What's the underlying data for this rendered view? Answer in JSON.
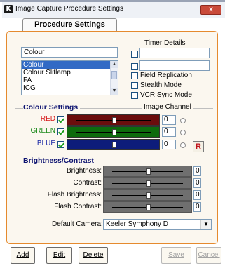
{
  "window": {
    "title": "Image Capture Procedure Settings",
    "close_glyph": "✕"
  },
  "tab": {
    "label": "Procedure Settings"
  },
  "procedure": {
    "input_value": "Colour",
    "list": [
      "Colour",
      "Colour Slitlamp",
      "FA",
      "ICG"
    ],
    "selected_index": 0
  },
  "timer": {
    "title": "Timer Details",
    "field1": "",
    "field2": ""
  },
  "options": [
    {
      "label": "Field Replication",
      "checked": false
    },
    {
      "label": "Stealth Mode",
      "checked": false
    },
    {
      "label": "VCR Sync Mode",
      "checked": false
    }
  ],
  "colour_settings": {
    "title": "Colour Settings",
    "image_channel_title": "Image Channel",
    "reset_label": "R",
    "channels": [
      {
        "label": "RED",
        "checked": true,
        "value": "0",
        "level": 0.5,
        "color": "#d61a1a",
        "track": "#6b0d0d"
      },
      {
        "label": "GREEN",
        "checked": true,
        "value": "0",
        "level": 0.5,
        "color": "#1a8a1a",
        "track": "#0d6b0d"
      },
      {
        "label": "BLUE",
        "checked": true,
        "value": "0",
        "level": 0.5,
        "color": "#1a28a6",
        "track": "#0d1c7a"
      }
    ]
  },
  "brightness": {
    "title": "Brightness/Contrast",
    "rows": [
      {
        "label": "Brightness:",
        "value": "0",
        "level": 0.5
      },
      {
        "label": "Contrast:",
        "value": "0",
        "level": 0.5
      },
      {
        "label": "Flash Brightness:",
        "value": "0",
        "level": 0.5
      },
      {
        "label": "Flash Contrast:",
        "value": "0",
        "level": 0.5
      }
    ]
  },
  "camera": {
    "label": "Default Camera:",
    "value": "Keeler Symphony D"
  },
  "buttons": {
    "add": "Add",
    "edit": "Edit",
    "delete": "Delete",
    "save": "Save",
    "cancel": "Cancel"
  },
  "colors": {
    "panel_border": "#e58a2e",
    "section_title": "#0c1270",
    "selection": "#316ac5",
    "slider_track": "#6f6f6f"
  }
}
